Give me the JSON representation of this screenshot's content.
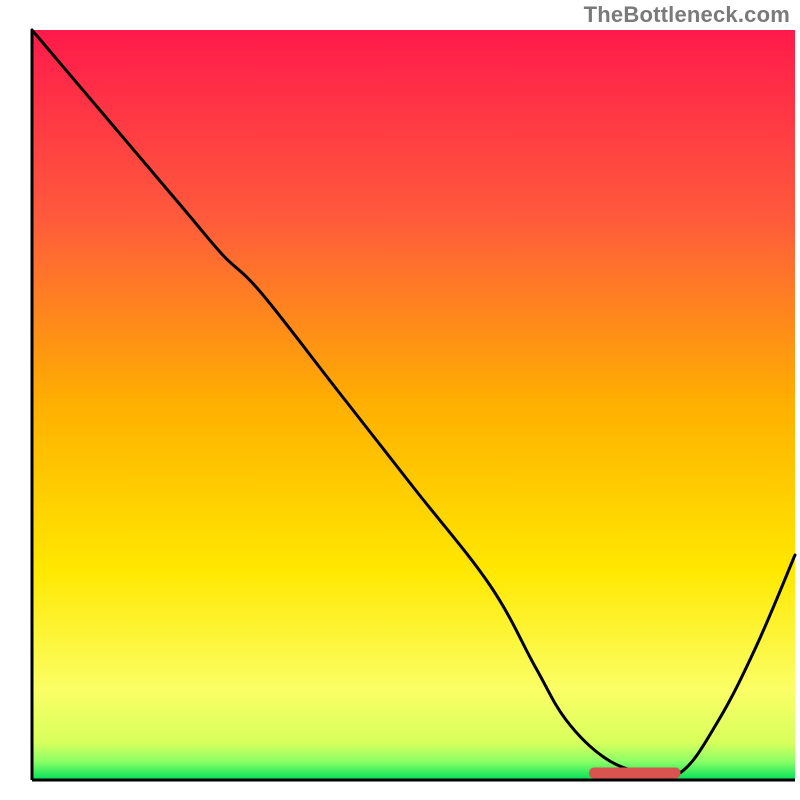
{
  "watermark": "TheBottleneck.com",
  "chart_data": {
    "type": "line",
    "title": "",
    "xlabel": "",
    "ylabel": "",
    "xlim": [
      0,
      100
    ],
    "ylim": [
      0,
      100
    ],
    "x": [
      0,
      10,
      20,
      25,
      30,
      40,
      50,
      60,
      66,
      70,
      75,
      80,
      85,
      90,
      95,
      100
    ],
    "values": [
      100,
      88,
      76,
      70,
      65,
      52,
      39,
      26,
      15,
      8,
      3,
      1,
      1,
      8,
      18,
      30
    ],
    "flat_region": {
      "x_start": 73,
      "x_end": 85,
      "y": 1
    },
    "marker": {
      "x_start": 73,
      "x_end": 85,
      "y": 1,
      "color": "#d9544f"
    },
    "gradient_stops": [
      {
        "offset": 0.0,
        "color": "#ff1a4b"
      },
      {
        "offset": 0.25,
        "color": "#ff5a3c"
      },
      {
        "offset": 0.5,
        "color": "#ffb000"
      },
      {
        "offset": 0.72,
        "color": "#ffe800"
      },
      {
        "offset": 0.88,
        "color": "#fbff66"
      },
      {
        "offset": 0.95,
        "color": "#d8ff5c"
      },
      {
        "offset": 0.975,
        "color": "#8cff66"
      },
      {
        "offset": 1.0,
        "color": "#00e05a"
      }
    ]
  }
}
